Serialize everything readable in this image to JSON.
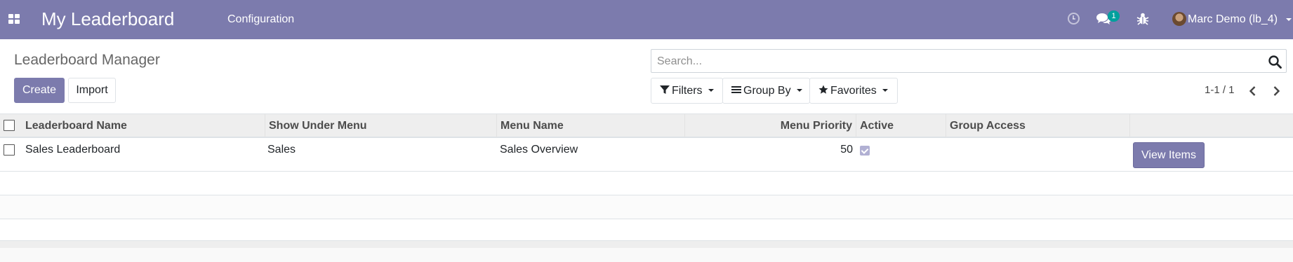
{
  "navbar": {
    "app_title": "My Leaderboard",
    "menu_configuration": "Configuration",
    "messages_badge": "1",
    "user_name": "Marc Demo (lb_4)",
    "icons": [
      "apps-icon",
      "clock-icon",
      "chat-icon",
      "bug-icon",
      "avatar"
    ],
    "color": "#7c7bad"
  },
  "control_panel": {
    "title": "Leaderboard Manager",
    "create_label": "Create",
    "import_label": "Import",
    "search_placeholder": "Search...",
    "filters_label": "Filters",
    "group_by_label": "Group By",
    "favorites_label": "Favorites",
    "pager_value": "1-1 / 1"
  },
  "table": {
    "columns": [
      "Leaderboard Name",
      "Show Under Menu",
      "Menu Name",
      "Menu Priority",
      "Active",
      "Group Access"
    ],
    "rows": [
      {
        "leaderboard_name": "Sales Leaderboard",
        "show_under_menu": "Sales",
        "menu_name": "Sales Overview",
        "menu_priority": "50",
        "active": true,
        "group_access": "",
        "action_label": "View Items"
      }
    ]
  }
}
